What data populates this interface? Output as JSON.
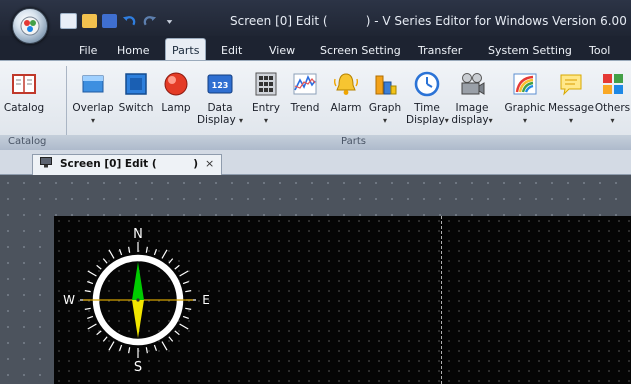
{
  "window": {
    "title": "Screen [0] Edit (          ) - V Series Editor for Windows Version 6.00"
  },
  "menu": {
    "tabs": [
      "File",
      "Home",
      "Parts",
      "Edit",
      "View",
      "Screen Setting",
      "Transfer",
      "System Setting",
      "Tool"
    ],
    "active": "Parts"
  },
  "ribbon": {
    "buttons": {
      "catalog": "Catalog",
      "overlap": "Overlap",
      "switch": "Switch",
      "lamp": "Lamp",
      "data_display_1": "Data",
      "data_display_2": "Display",
      "entry": "Entry",
      "trend": "Trend",
      "alarm": "Alarm",
      "graph": "Graph",
      "time_display_1": "Time",
      "time_display_2": "Display",
      "image_display_1": "Image",
      "image_display_2": "display",
      "graphic": "Graphic",
      "message": "Message",
      "others": "Others"
    },
    "groups": {
      "catalog": "Catalog",
      "parts": "Parts"
    },
    "icons": {
      "data_display_text": "123"
    }
  },
  "document": {
    "tab_label": "Screen [0] Edit (          )",
    "close_glyph": "×"
  },
  "compass": {
    "north": "N",
    "south": "S",
    "east": "E",
    "west": "W"
  },
  "colors": {
    "needle_north": "#00cc00",
    "needle_south": "#f2e600",
    "canvas": "#050505"
  }
}
